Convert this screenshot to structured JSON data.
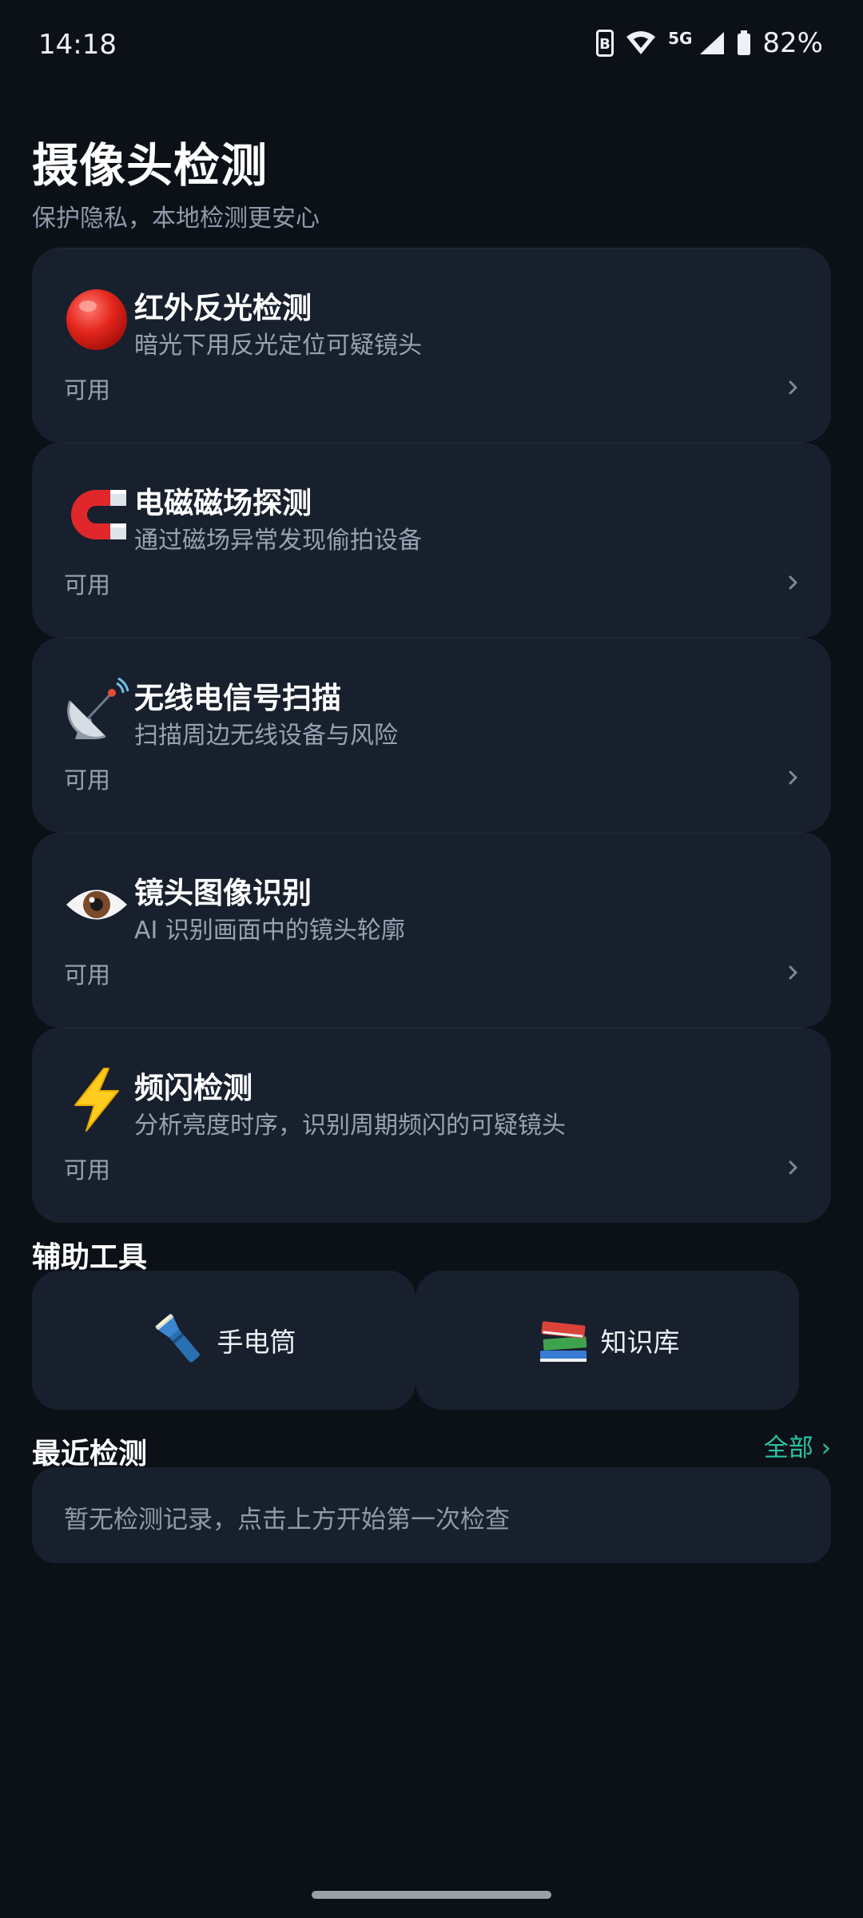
{
  "status_bar": {
    "time": "14:18",
    "network": "5G",
    "battery": "82%"
  },
  "header": {
    "title": "摄像头检测",
    "subtitle": "保护隐私，本地检测更安心"
  },
  "features": [
    {
      "icon": "red-circle-icon",
      "title": "红外反光检测",
      "desc": "暗光下用反光定位可疑镜头",
      "status": "可用"
    },
    {
      "icon": "magnet-icon",
      "title": "电磁磁场探测",
      "desc": "通过磁场异常发现偷拍设备",
      "status": "可用"
    },
    {
      "icon": "satellite-dish-icon",
      "title": "无线电信号扫描",
      "desc": "扫描周边无线设备与风险",
      "status": "可用"
    },
    {
      "icon": "eye-icon",
      "title": "镜头图像识别",
      "desc": "AI 识别画面中的镜头轮廓",
      "status": "可用"
    },
    {
      "icon": "lightning-icon",
      "title": "频闪检测",
      "desc": "分析亮度时序，识别周期频闪的可疑镜头",
      "status": "可用"
    }
  ],
  "tools": {
    "title": "辅助工具",
    "items": [
      {
        "icon": "flashlight-icon",
        "label": "手电筒"
      },
      {
        "icon": "books-icon",
        "label": "知识库"
      }
    ]
  },
  "recent": {
    "title": "最近检测",
    "see_all": "全部 ›",
    "empty": "暂无检测记录，点击上方开始第一次检查"
  },
  "colors": {
    "background": "#0c1118",
    "card": "#18202d",
    "accent": "#2bc3a3"
  }
}
